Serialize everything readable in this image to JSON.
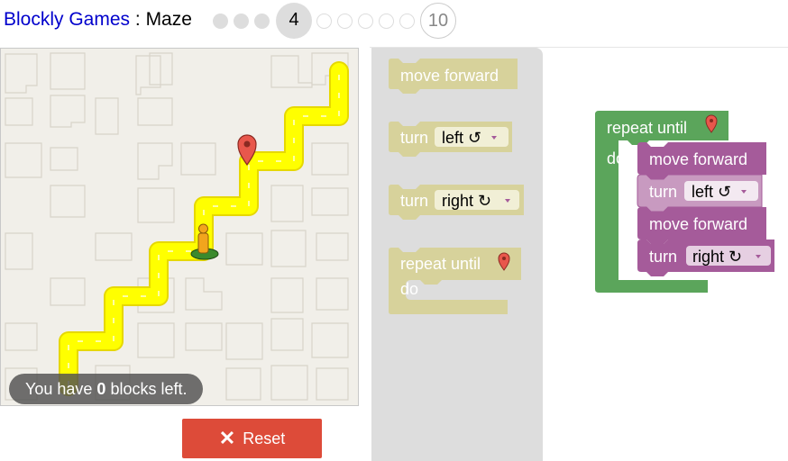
{
  "header": {
    "app_name": "Blockly Games",
    "separator": " : ",
    "game_name": "Maze",
    "current_level": "4",
    "last_level": "10"
  },
  "status": {
    "prefix": "You have ",
    "count": "0",
    "suffix": " blocks left."
  },
  "reset_button": {
    "label": "Reset",
    "icon": "close-icon"
  },
  "toolbox": {
    "move_forward": "move forward",
    "turn_left_word": "turn",
    "turn_left_dir": "left ↺",
    "turn_right_word": "turn",
    "turn_right_dir": "right ↻",
    "repeat_until": "repeat until",
    "do": "do"
  },
  "program": {
    "repeat_until": "repeat until",
    "do": "do",
    "step1": "move forward",
    "step2_word": "turn",
    "step2_dir": "left ↺",
    "step3": "move forward",
    "step4_word": "turn",
    "step4_dir": "right ↻"
  },
  "colors": {
    "movement_block": "#a55b9a",
    "loop_block": "#5ba55b",
    "reset": "#dd4b39",
    "path": "#ffff00",
    "marker": "#e8574c"
  }
}
